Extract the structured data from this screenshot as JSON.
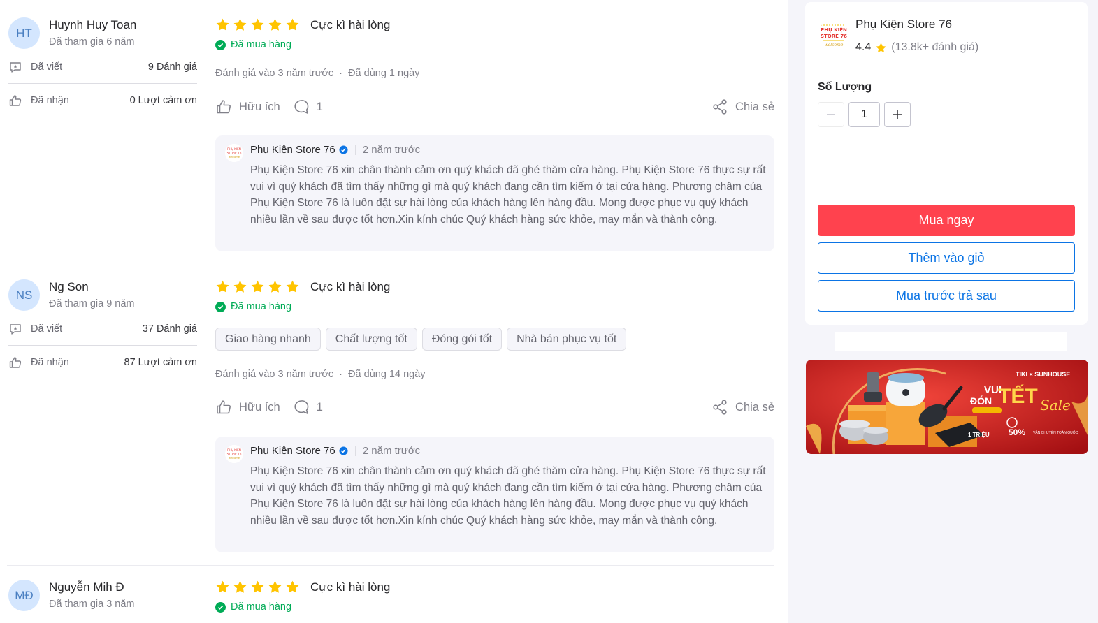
{
  "reviews": [
    {
      "avatar": "HT",
      "name": "Huynh Huy Toan",
      "joined": "Đã tham gia 6 năm",
      "written_label": "Đã viết",
      "written_value": "9 Đánh giá",
      "received_label": "Đã nhận",
      "received_value": "0 Lượt cảm ơn",
      "stars": 5,
      "title": "Cực kì hài lòng",
      "bought": "Đã mua hàng",
      "tags": [],
      "meta": "Đánh giá vào 3 năm trước  ·  Đã dùng 1 ngày",
      "helpful": "Hữu ích",
      "comments": "1",
      "share": "Chia sẻ",
      "reply": {
        "shop": "Phụ Kiện Store 76",
        "time": "2 năm trước",
        "text": "Phụ Kiện Store 76 xin chân thành cảm ơn quý khách đã ghé thăm cửa hàng. Phụ Kiện Store 76 thực sự rất vui vì quý khách đã tìm thấy những gì mà quý khách đang cần tìm kiếm ở tại cửa hàng. Phương châm của Phụ Kiện Store 76 là luôn đặt sự hài lòng của khách hàng lên hàng đầu. Mong được phục vụ quý khách nhiều lần về sau được tốt hơn.Xin kính chúc Quý khách hàng sức khỏe, may mắn và thành công."
      }
    },
    {
      "avatar": "NS",
      "name": "Ng Son",
      "joined": "Đã tham gia 9 năm",
      "written_label": "Đã viết",
      "written_value": "37 Đánh giá",
      "received_label": "Đã nhận",
      "received_value": "87 Lượt cảm ơn",
      "stars": 5,
      "title": "Cực kì hài lòng",
      "bought": "Đã mua hàng",
      "tags": [
        "Giao hàng nhanh",
        "Chất lượng tốt",
        "Đóng gói tốt",
        "Nhà bán phục vụ tốt"
      ],
      "meta": "Đánh giá vào 3 năm trước  ·  Đã dùng 14 ngày",
      "helpful": "Hữu ích",
      "comments": "1",
      "share": "Chia sẻ",
      "reply": {
        "shop": "Phụ Kiện Store 76",
        "time": "2 năm trước",
        "text": "Phụ Kiện Store 76 xin chân thành cảm ơn quý khách đã ghé thăm cửa hàng. Phụ Kiện Store 76 thực sự rất vui vì quý khách đã tìm thấy những gì mà quý khách đang cần tìm kiếm ở tại cửa hàng. Phương châm của Phụ Kiện Store 76 là luôn đặt sự hài lòng của khách hàng lên hàng đầu. Mong được phục vụ quý khách nhiều lần về sau được tốt hơn.Xin kính chúc Quý khách hàng sức khỏe, may mắn và thành công."
      }
    },
    {
      "avatar": "MĐ",
      "name": "Nguyễn Mih Đ",
      "joined": "Đã tham gia 3 năm",
      "stars": 5,
      "title": "Cực kì hài lòng",
      "bought": "Đã mua hàng"
    }
  ],
  "seller": {
    "name": "Phụ Kiện Store 76",
    "rating": "4.4",
    "rating_count": "(13.8k+ đánh giá)",
    "logo_text": [
      "PHỤ KIỆN",
      "STORE 76",
      "welcome"
    ]
  },
  "purchase": {
    "qty_label": "Số Lượng",
    "qty_value": "1",
    "buy_now": "Mua ngay",
    "add_to_cart": "Thêm vào giỏ",
    "bnpl": "Mua trước trả sau"
  },
  "banner": {
    "brand": "TIKI × SUNHOUSE",
    "line1": "VUI",
    "line2": "ĐÓN",
    "tet": "TẾT",
    "sale": "Sale",
    "promo": "1 TRIỆU",
    "discount": "50%",
    "ship": "VẬN CHUYỂN TOÀN QUỐC"
  },
  "colors": {
    "star": "#ffc400",
    "bought": "#00ab56",
    "primary": "#ff424e",
    "link": "#0b74e5"
  }
}
